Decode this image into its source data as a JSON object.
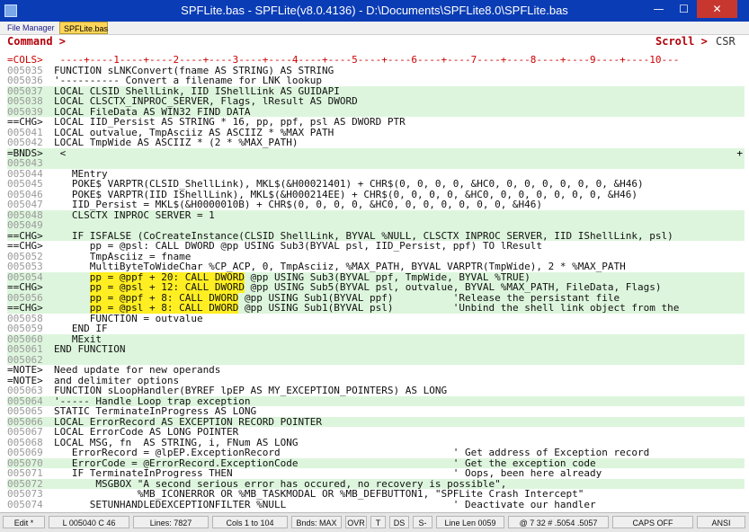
{
  "window": {
    "title": "SPFLite.bas - SPFLite(v8.0.4136) - D:\\Documents\\SPFLite8.0\\SPFLite.bas",
    "min_glyph": "—",
    "max_glyph": "☐",
    "close_glyph": "✕"
  },
  "tabs": [
    {
      "label": "File Manager"
    },
    {
      "label": "SPFLite.bas"
    }
  ],
  "command": {
    "label": "Command >",
    "scroll_label": "Scroll >",
    "scroll_value": "CSR"
  },
  "lines": [
    {
      "prefix": "=COLS>",
      "text": " ----+----1----+----2----+----3----+----4----+----5----+----6----+----7----+----8----+----9----+----10---",
      "shade": false
    },
    {
      "prefix": "005035",
      "text": "FUNCTION sLNKConvert(fname AS STRING) AS STRING",
      "shade": false
    },
    {
      "prefix": "005036",
      "text": "'---------- Convert a filename for LNK lookup",
      "shade": false
    },
    {
      "prefix": "005037",
      "text": "LOCAL CLSID_ShellLink, IID_IShellLink AS GUIDAPI",
      "shade": true
    },
    {
      "prefix": "005038",
      "text": "LOCAL CLSCTX_INPROC_SERVER, Flags, lResult AS DWORD",
      "shade": true
    },
    {
      "prefix": "005039",
      "text": "LOCAL FileData AS WIN32_FIND_DATA",
      "shade": true
    },
    {
      "prefix": "==CHG>",
      "text": "LOCAL IID_Persist AS STRING * 16, pp, ppf, psl AS DWORD PTR",
      "shade": false
    },
    {
      "prefix": "005041",
      "text": "LOCAL outvalue, TmpAsciiz AS ASCIIZ * %MAX_PATH",
      "shade": false
    },
    {
      "prefix": "005042",
      "text": "LOCAL TmpWide AS ASCIIZ * (2 * %MAX_PATH)",
      "shade": false
    },
    {
      "prefix": "=BNDS>",
      "text": " <",
      "shade": true,
      "right": "+"
    },
    {
      "prefix": "005043",
      "text": "",
      "shade": true
    },
    {
      "prefix": "005044",
      "text": "   MEntry",
      "shade": false
    },
    {
      "prefix": "005045",
      "text": "   POKE$ VARPTR(CLSID_ShellLink), MKL$(&H00021401) + CHR$(0, 0, 0, 0, &HC0, 0, 0, 0, 0, 0, 0, &H46)",
      "shade": false
    },
    {
      "prefix": "005046",
      "text": "   POKE$ VARPTR(IID_IShellLink), MKL$(&H000214EE) + CHR$(0, 0, 0, 0, &HC0, 0, 0, 0, 0, 0, 0, &H46)",
      "shade": false
    },
    {
      "prefix": "005047",
      "text": "   IID_Persist = MKL$(&H0000010B) + CHR$(0, 0, 0, 0, &HC0, 0, 0, 0, 0, 0, 0, &H46)",
      "shade": false
    },
    {
      "prefix": "005048",
      "text": "   CLSCTX_INPROC_SERVER = 1",
      "shade": true
    },
    {
      "prefix": "005049",
      "text": "",
      "shade": true
    },
    {
      "prefix": "==CHG>",
      "text": "   IF ISFALSE (CoCreateInstance(CLSID_ShellLink, BYVAL %NULL, CLSCTX_INPROC_SERVER, IID_IShellLink, psl)",
      "shade": true
    },
    {
      "prefix": "==CHG>",
      "text": "      pp = @psl: CALL DWORD @pp USING Sub3(BYVAL psl, IID_Persist, ppf) TO lResult",
      "shade": false
    },
    {
      "prefix": "005052",
      "text": "      TmpAsciiz = fname",
      "shade": false
    },
    {
      "prefix": "005053",
      "text": "      MultiByteToWideChar %CP_ACP, 0, TmpAsciiz, %MAX_PATH, BYVAL VARPTR(TmpWide), 2 * %MAX_PATH",
      "shade": false
    },
    {
      "prefix": "005054",
      "text": "      ",
      "hl": "pp = @ppf + 20: CALL DWORD",
      "after": " @pp USING Sub3(BYVAL ppf, TmpWide, BYVAL %TRUE)",
      "shade": true
    },
    {
      "prefix": "==CHG>",
      "text": "      ",
      "hl": "pp = @psl + 12: CALL DWORD",
      "after": " @pp USING Sub5(BYVAL psl, outvalue, BYVAL %MAX_PATH, FileData, Flags)",
      "shade": true
    },
    {
      "prefix": "005056",
      "text": "      ",
      "hl": "pp = @ppf + 8: CALL DWORD",
      "after": " @pp USING Sub1(BYVAL ppf)          'Release the persistant file",
      "shade": true
    },
    {
      "prefix": "==CHG>",
      "text": "      ",
      "hl": "pp = @psl + 8: CALL DWORD",
      "after": " @pp USING Sub1(BYVAL psl)          'Unbind the shell link object from the",
      "shade": true
    },
    {
      "prefix": "005058",
      "text": "      FUNCTION = outvalue",
      "shade": false
    },
    {
      "prefix": "005059",
      "text": "   END IF",
      "shade": false
    },
    {
      "prefix": "005060",
      "text": "   MExit",
      "shade": true
    },
    {
      "prefix": "005061",
      "text": "END FUNCTION",
      "shade": true
    },
    {
      "prefix": "005062",
      "text": "",
      "shade": true
    },
    {
      "prefix": "=NOTE>",
      "text": "Need update for new operands",
      "shade": false
    },
    {
      "prefix": "=NOTE>",
      "text": "and delimiter options",
      "shade": false
    },
    {
      "prefix": "005063",
      "text": "FUNCTION sLoopHandler(BYREF lpEP AS MY_EXCEPTION_POINTERS) AS LONG",
      "shade": false
    },
    {
      "prefix": "005064",
      "text": "'----- Handle Loop trap exception",
      "shade": true
    },
    {
      "prefix": "005065",
      "text": "STATIC TerminateInProgress AS LONG",
      "shade": false
    },
    {
      "prefix": "005066",
      "text": "LOCAL ErrorRecord AS EXCEPTION_RECORD POINTER",
      "shade": true
    },
    {
      "prefix": "005067",
      "text": "LOCAL ErrorCode AS LONG POINTER",
      "shade": false
    },
    {
      "prefix": "005068",
      "text": "LOCAL MSG, fn  AS STRING, i, FNum AS LONG",
      "shade": false
    },
    {
      "prefix": "005069",
      "text": "   ErrorRecord = @lpEP.ExceptionRecord                             ' Get address of Exception record",
      "shade": false
    },
    {
      "prefix": "005070",
      "text": "   ErrorCode = @ErrorRecord.ExceptionCode                          ' Get the exception code",
      "shade": true
    },
    {
      "prefix": "005071",
      "text": "   IF TerminateInProgress THEN                                     ' Oops, been here already",
      "shade": false
    },
    {
      "prefix": "005072",
      "text": "       MSGBOX \"A second serious error has occured, no recovery is possible\", _",
      "shade": true
    },
    {
      "prefix": "005073",
      "text": "              %MB_ICONERROR OR %MB_TASKMODAL OR %MB_DEFBUTTON1, \"SPFLite Crash Intercept\"",
      "shade": false
    },
    {
      "prefix": "005074",
      "text": "      SETUNHANDLEDEXCEPTIONFILTER %NULL                            ' Deactivate our handler",
      "shade": false
    }
  ],
  "status": [
    {
      "label": "Edit *"
    },
    {
      "label": "L 005040  C 46"
    },
    {
      "label": "Lines: 7827"
    },
    {
      "label": "Cols 1 to 104"
    },
    {
      "label": "Bnds: MAX"
    },
    {
      "label": "OVR"
    },
    {
      "label": "T"
    },
    {
      "label": "DS"
    },
    {
      "label": "S-"
    },
    {
      "label": "Line Len 0059"
    },
    {
      "label": "@ 7 32  # .5054 .5057"
    },
    {
      "label": "CAPS OFF"
    },
    {
      "label": "ANSI"
    }
  ]
}
